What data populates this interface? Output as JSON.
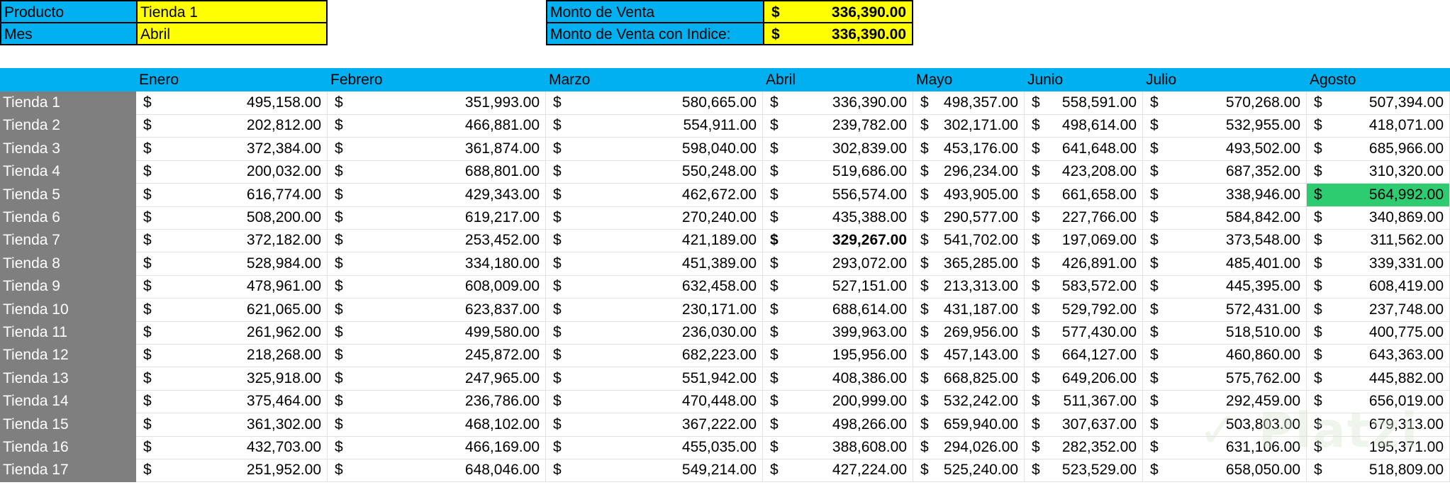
{
  "header": {
    "producto_label": "Producto",
    "producto_value": "Tienda 1",
    "mes_label": "Mes",
    "mes_value": "Abril",
    "monto_label": "Monto de Venta",
    "monto_value": "336,390.00",
    "monto_indice_label": "Monto de Venta con Indice:",
    "monto_indice_value": "336,390.00",
    "currency": "$"
  },
  "colors": {
    "header_blue": "#00b0f0",
    "input_yellow": "#ffff00",
    "store_gray": "#7f7f7f",
    "highlight_green": "#2ecc71"
  },
  "table": {
    "columns": [
      "Enero",
      "Febrero",
      "Marzo",
      "Abril",
      "Mayo",
      "Junio",
      "Julio",
      "Agosto"
    ],
    "rows": [
      {
        "store": "Tienda 1",
        "values": [
          "495,158.00",
          "351,993.00",
          "580,665.00",
          "336,390.00",
          "498,357.00",
          "558,591.00",
          "570,268.00",
          "507,394.00"
        ]
      },
      {
        "store": "Tienda 2",
        "values": [
          "202,812.00",
          "466,881.00",
          "554,911.00",
          "239,782.00",
          "302,171.00",
          "498,614.00",
          "532,955.00",
          "418,071.00"
        ]
      },
      {
        "store": "Tienda 3",
        "values": [
          "372,384.00",
          "361,874.00",
          "598,040.00",
          "302,839.00",
          "453,176.00",
          "641,648.00",
          "493,502.00",
          "685,966.00"
        ]
      },
      {
        "store": "Tienda 4",
        "values": [
          "200,032.00",
          "688,801.00",
          "550,248.00",
          "519,686.00",
          "296,234.00",
          "423,208.00",
          "687,352.00",
          "310,320.00"
        ]
      },
      {
        "store": "Tienda 5",
        "values": [
          "616,774.00",
          "429,343.00",
          "462,672.00",
          "556,574.00",
          "493,905.00",
          "661,658.00",
          "338,946.00",
          "564,992.00"
        ]
      },
      {
        "store": "Tienda 6",
        "values": [
          "508,200.00",
          "619,217.00",
          "270,240.00",
          "435,388.00",
          "290,577.00",
          "227,766.00",
          "584,842.00",
          "340,869.00"
        ]
      },
      {
        "store": "Tienda 7",
        "values": [
          "372,182.00",
          "253,452.00",
          "421,189.00",
          "329,267.00",
          "541,702.00",
          "197,069.00",
          "373,548.00",
          "311,562.00"
        ]
      },
      {
        "store": "Tienda 8",
        "values": [
          "528,984.00",
          "334,180.00",
          "451,389.00",
          "293,072.00",
          "365,285.00",
          "426,891.00",
          "485,401.00",
          "339,331.00"
        ]
      },
      {
        "store": "Tienda 9",
        "values": [
          "478,961.00",
          "608,009.00",
          "632,458.00",
          "527,151.00",
          "213,313.00",
          "583,572.00",
          "445,395.00",
          "608,419.00"
        ]
      },
      {
        "store": "Tienda 10",
        "values": [
          "621,065.00",
          "623,837.00",
          "230,171.00",
          "688,614.00",
          "431,187.00",
          "529,792.00",
          "572,431.00",
          "237,748.00"
        ]
      },
      {
        "store": "Tienda 11",
        "values": [
          "261,962.00",
          "499,580.00",
          "236,030.00",
          "399,963.00",
          "269,956.00",
          "577,430.00",
          "518,510.00",
          "400,775.00"
        ]
      },
      {
        "store": "Tienda 12",
        "values": [
          "218,268.00",
          "245,872.00",
          "682,223.00",
          "195,956.00",
          "457,143.00",
          "664,127.00",
          "460,860.00",
          "643,363.00"
        ]
      },
      {
        "store": "Tienda 13",
        "values": [
          "325,918.00",
          "247,965.00",
          "551,942.00",
          "408,386.00",
          "668,825.00",
          "649,206.00",
          "575,762.00",
          "445,882.00"
        ]
      },
      {
        "store": "Tienda 14",
        "values": [
          "375,464.00",
          "236,786.00",
          "470,448.00",
          "200,999.00",
          "532,242.00",
          "511,367.00",
          "292,459.00",
          "656,019.00"
        ]
      },
      {
        "store": "Tienda 15",
        "values": [
          "361,302.00",
          "468,102.00",
          "367,222.00",
          "498,266.00",
          "659,940.00",
          "307,637.00",
          "503,803.00",
          "679,313.00"
        ]
      },
      {
        "store": "Tienda 16",
        "values": [
          "432,703.00",
          "466,169.00",
          "455,035.00",
          "388,608.00",
          "294,026.00",
          "282,352.00",
          "631,106.00",
          "195,371.00"
        ]
      },
      {
        "store": "Tienda 17",
        "values": [
          "251,952.00",
          "648,046.00",
          "549,214.00",
          "427,224.00",
          "525,240.00",
          "523,529.00",
          "658,050.00",
          "518,809.00"
        ]
      }
    ]
  }
}
